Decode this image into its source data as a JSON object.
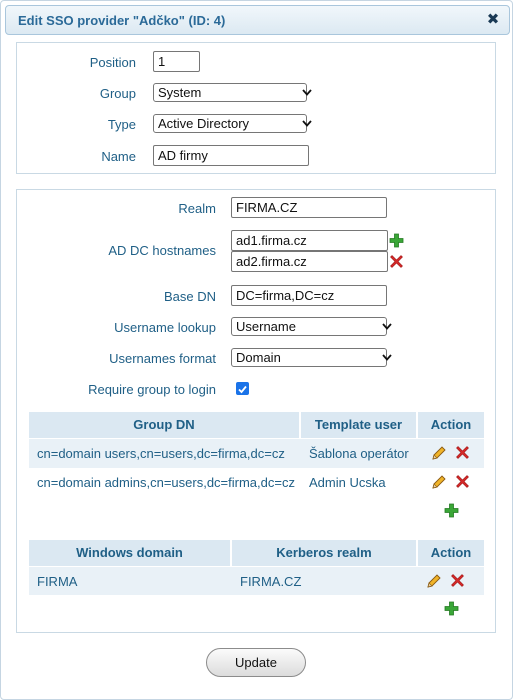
{
  "dialog": {
    "title": "Edit SSO provider \"Adčko\" (ID: 4)",
    "close_glyph": "✖"
  },
  "general": {
    "position_label": "Position",
    "position_value": "1",
    "group_label": "Group",
    "group_value": "System",
    "type_label": "Type",
    "type_value": "Active Directory",
    "name_label": "Name",
    "name_value": "AD firmy"
  },
  "settings": {
    "realm_label": "Realm",
    "realm_value": "FIRMA.CZ",
    "hostnames_label": "AD DC hostnames",
    "hostnames": [
      "ad1.firma.cz",
      "ad2.firma.cz"
    ],
    "base_dn_label": "Base DN",
    "base_dn_value": "DC=firma,DC=cz",
    "username_lookup_label": "Username lookup",
    "username_lookup_value": "Username",
    "usernames_format_label": "Usernames format",
    "usernames_format_value": "Domain",
    "require_group_label": "Require group to login",
    "require_group_checked": true
  },
  "group_table": {
    "headers": [
      "Group DN",
      "Template user",
      "Action"
    ],
    "rows": [
      {
        "group_dn": "cn=domain users,cn=users,dc=firma,dc=cz",
        "template_user": "Šablona operátor"
      },
      {
        "group_dn": "cn=domain admins,cn=users,dc=firma,dc=cz",
        "template_user": "Admin Ucska"
      }
    ]
  },
  "domain_table": {
    "headers": [
      "Windows domain",
      "Kerberos realm",
      "Action"
    ],
    "rows": [
      {
        "windows_domain": "FIRMA",
        "kerberos_realm": "FIRMA.CZ"
      }
    ]
  },
  "icons": {
    "add": "plus-icon",
    "remove": "x-icon",
    "edit": "pencil-icon"
  },
  "colors": {
    "label": "#1f5f86",
    "header_bg": "#dbe8f2",
    "row_bg": "#e9f1f7",
    "add_green": "#3aa637",
    "remove_red": "#d62a2a"
  },
  "footer": {
    "update_label": "Update"
  }
}
